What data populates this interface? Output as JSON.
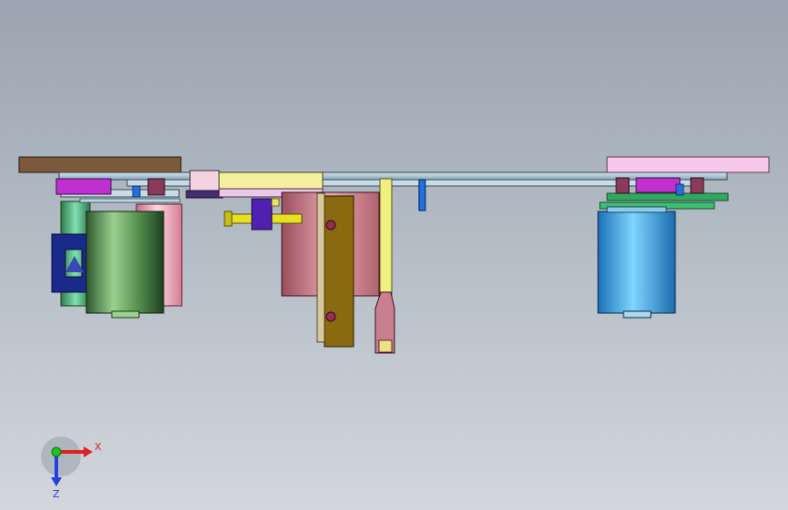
{
  "viewport": {
    "background_top": "#9aa5b1",
    "background_bottom": "#d3d7dc"
  },
  "triad": {
    "x_label": "X",
    "z_label": "Z",
    "x_color": "#e02020",
    "y_color": "#20c020",
    "z_color": "#2040e0"
  },
  "parts": [
    {
      "name": "left-top-plate",
      "color": "#7a5a3a"
    },
    {
      "name": "right-top-plate",
      "color": "#f7c8ec"
    },
    {
      "name": "main-rail",
      "color": "#a8c8d8"
    },
    {
      "name": "center-block",
      "color": "#f4f0a0"
    },
    {
      "name": "left-green-cylinder",
      "color": "#3f7a3f"
    },
    {
      "name": "left-pink-cylinder",
      "color": "#e89ab0"
    },
    {
      "name": "center-pink-cylinder",
      "color": "#c87080"
    },
    {
      "name": "right-blue-cylinder",
      "color": "#2a9fe8"
    },
    {
      "name": "navy-clamp",
      "color": "#1a2a8a"
    },
    {
      "name": "olive-bracket",
      "color": "#8a6a10"
    },
    {
      "name": "yellow-bar",
      "color": "#f0f080"
    },
    {
      "name": "pink-nozzle",
      "color": "#c88090"
    },
    {
      "name": "yellow-pin",
      "color": "#e0d020"
    },
    {
      "name": "purple-block",
      "color": "#5020b0"
    },
    {
      "name": "blue-screw",
      "color": "#2070e0"
    }
  ]
}
